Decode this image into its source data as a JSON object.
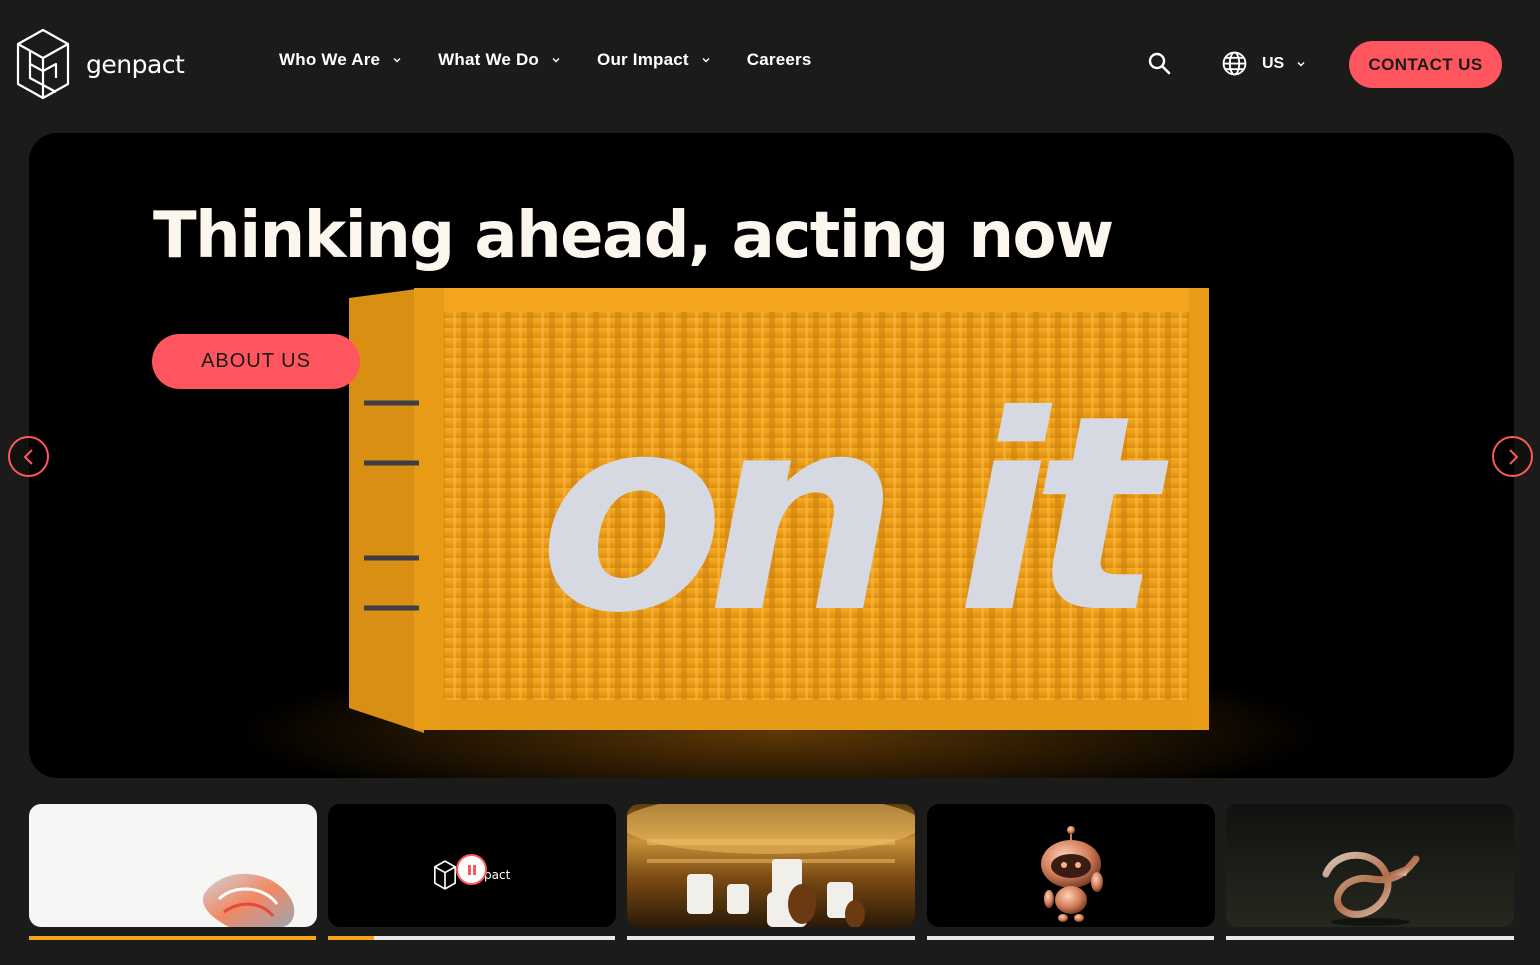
{
  "header": {
    "logo_text": "genpact",
    "nav": [
      {
        "label": "Who We Are",
        "has_dropdown": true
      },
      {
        "label": "What We Do",
        "has_dropdown": true
      },
      {
        "label": "Our Impact",
        "has_dropdown": true
      },
      {
        "label": "Careers",
        "has_dropdown": false
      }
    ],
    "search_icon": "search-icon",
    "locale": {
      "icon": "globe-icon",
      "label": "US"
    },
    "contact_label": "CONTACT US"
  },
  "hero": {
    "title": "Thinking ahead, acting now",
    "cta_label": "ABOUT US",
    "container_text": "on it",
    "prev_icon": "chevron-left-icon",
    "next_icon": "chevron-right-icon"
  },
  "carousel": {
    "slides": [
      {
        "name": "slide-1",
        "progress": 1.0
      },
      {
        "name": "slide-2",
        "progress": 0.16,
        "overlay_text": "pact",
        "pause_icon": "pause-icon"
      },
      {
        "name": "slide-3",
        "progress": 0
      },
      {
        "name": "slide-4",
        "progress": 0
      },
      {
        "name": "slide-5",
        "progress": 0
      }
    ]
  },
  "colors": {
    "background": "#1b1c1a",
    "accent": "#ff555f",
    "container_orange": "#f2a21d",
    "progress_active": "#f6a21b",
    "title_text": "#fbf6ee"
  }
}
